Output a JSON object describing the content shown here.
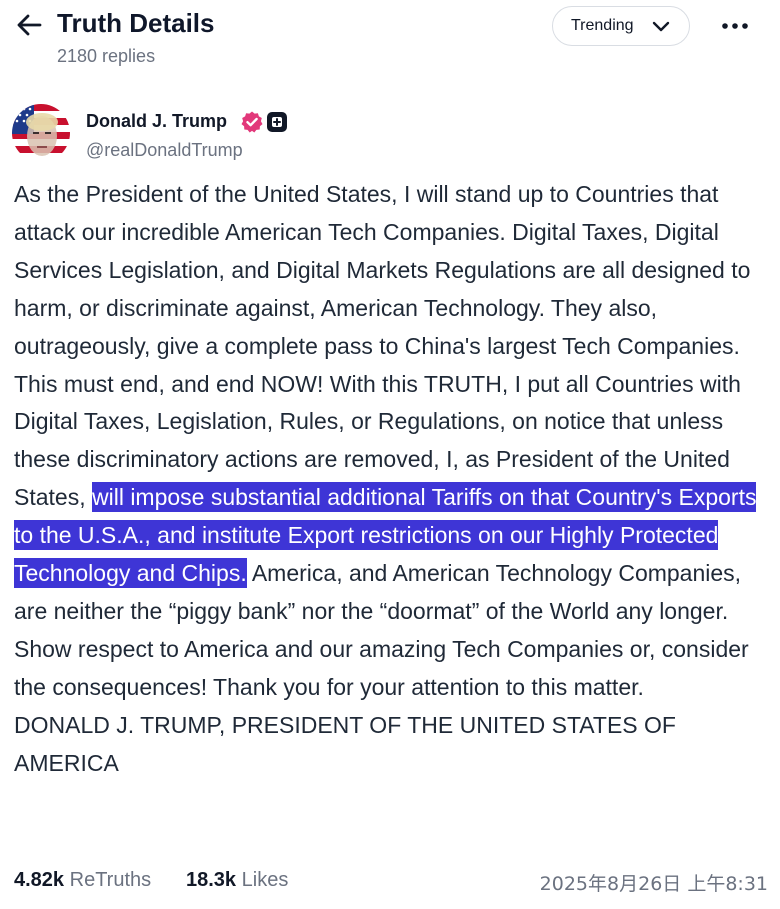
{
  "header": {
    "back_icon": "arrow-left-icon",
    "title": "Truth Details",
    "replies": "2180 replies",
    "sort_label": "Trending",
    "more_icon": "more-horizontal-icon"
  },
  "author": {
    "name": "Donald J. Trump",
    "handle": "@realDonaldTrump",
    "verified_icon": "verified-badge-icon",
    "verified_color": "#e2387a"
  },
  "post": {
    "text_before": "As the President of the United States, I will stand up to Countries that attack our incredible American Tech Companies. Digital Taxes, Digital Services Legislation, and Digital Markets Regulations are all designed to harm, or discriminate against, American Technology. They also, outrageously, give a complete pass to China's largest Tech Companies. This must end, and end NOW! With this TRUTH, I put all Countries with Digital Taxes, Legislation, Rules, or Regulations, on notice that unless these discriminatory actions are removed, I, as President of the United States, ",
    "text_highlighted": "will impose substantial additional Tariffs on that Country's Exports to the U.S.A., and institute Export restrictions on our Highly Protected Technology and Chips.",
    "text_after": " America, and American Technology Companies, are neither the “piggy bank” nor the “doormat” of the World any longer. Show respect to America and our amazing Tech Companies or, consider the consequences! Thank you for your attention to this matter.",
    "signature": "DONALD J. TRUMP, PRESIDENT OF THE UNITED STATES OF AMERICA",
    "highlight_color": "#3e35d6"
  },
  "stats": {
    "retruths_count": "4.82k",
    "retruths_label": "ReTruths",
    "likes_count": "18.3k",
    "likes_label": "Likes",
    "timestamp": "2025年8月26日 上午8:31"
  }
}
